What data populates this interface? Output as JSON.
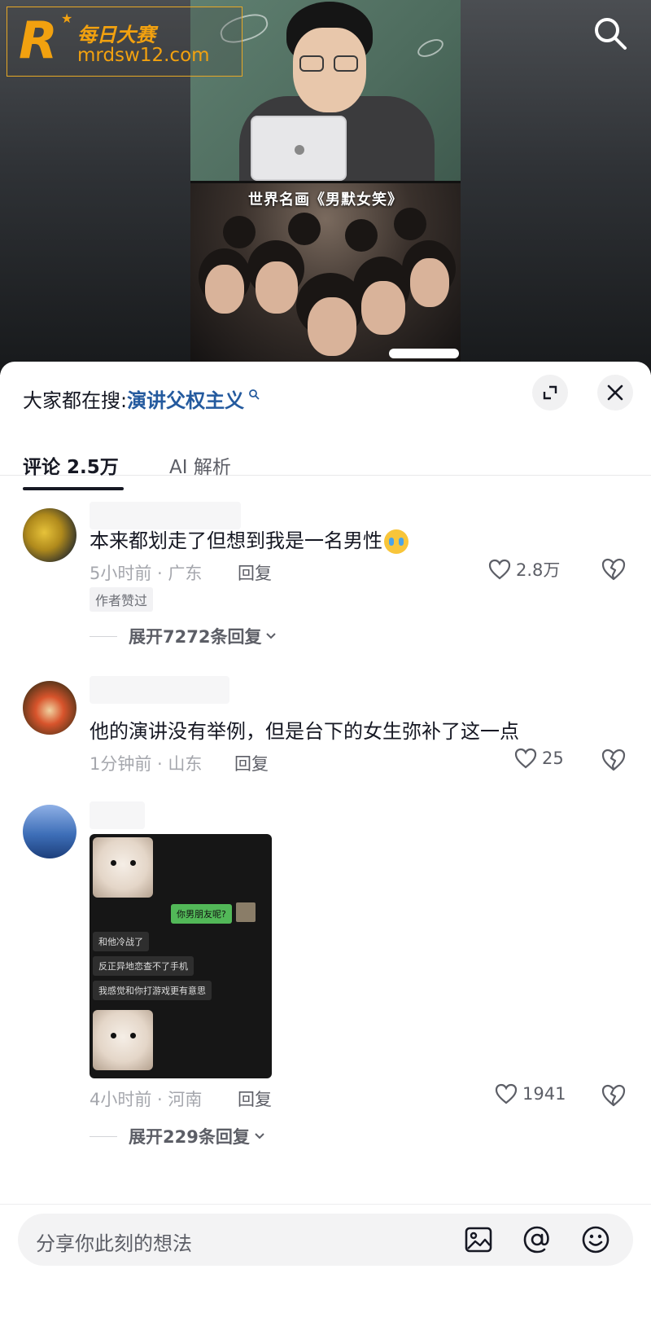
{
  "watermark": {
    "logo_letter": "R",
    "brand_name": "每日大赛",
    "url": "mrdsw12.com"
  },
  "video": {
    "caption": "世界名画《男默女笑》"
  },
  "sheet": {
    "hot_search_label": "大家都在搜:",
    "hot_search_keyword": "演讲父权主义",
    "tabs": [
      {
        "label": "评论 2.5万",
        "active": true
      },
      {
        "label": "AI 解析",
        "active": false
      }
    ]
  },
  "comments": [
    {
      "text": "本来都划走了但想到我是一名男性",
      "has_emoji": true,
      "emoji": "crying-face",
      "meta": "5小时前 · 广东",
      "reply_label": "回复",
      "likes": "2.8万",
      "badge": "作者赞过",
      "expand_label": "展开7272条回复"
    },
    {
      "text": "他的演讲没有举例，但是台下的女生弥补了这一点",
      "meta": "1分钟前 · 山东",
      "reply_label": "回复",
      "likes": "25"
    },
    {
      "image_chat": {
        "bubble_sent": "你男朋友呢?",
        "bubbles_received": [
          "和他冷战了",
          "反正异地恋查不了手机",
          "我感觉和你打游戏更有意思"
        ]
      },
      "meta": "4小时前 · 河南",
      "reply_label": "回复",
      "likes": "1941",
      "expand_label": "展开229条回复"
    }
  ],
  "composer": {
    "placeholder": "分享你此刻的想法",
    "icons": [
      "image-icon",
      "at-icon",
      "emoji-icon"
    ]
  },
  "colors": {
    "keyword_blue": "#245a9e",
    "watermark_orange": "#f2a10f",
    "text_primary": "#161823",
    "text_secondary": "#a5a7ad"
  }
}
